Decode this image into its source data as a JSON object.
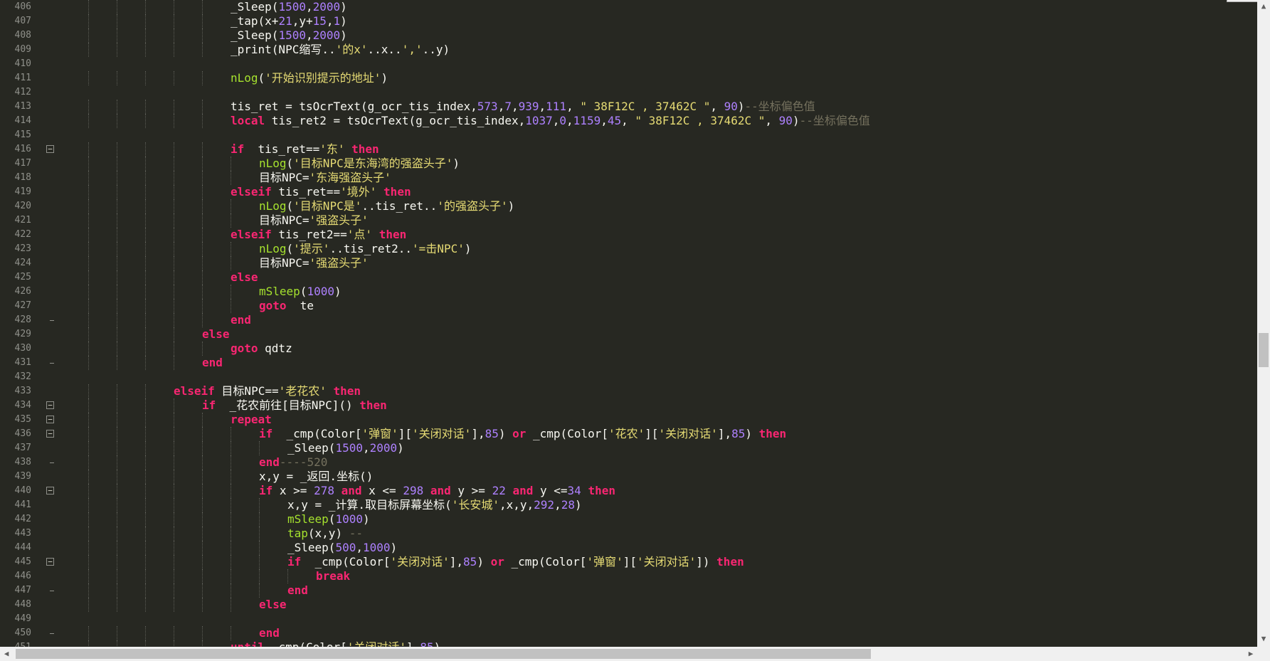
{
  "editor": {
    "lines": [
      {
        "n": "406",
        "indent": 6,
        "tokens": [
          [
            "_Sleep",
            "id"
          ],
          [
            "(",
            "id"
          ],
          [
            "1500",
            "num"
          ],
          [
            ",",
            "id"
          ],
          [
            "2000",
            "num"
          ],
          [
            ")",
            "id"
          ]
        ]
      },
      {
        "n": "407",
        "indent": 6,
        "tokens": [
          [
            "_tap",
            "id"
          ],
          [
            "(x+",
            "id"
          ],
          [
            "21",
            "num"
          ],
          [
            ",y+",
            "id"
          ],
          [
            "15",
            "num"
          ],
          [
            ",",
            "id"
          ],
          [
            "1",
            "num"
          ],
          [
            ")",
            "id"
          ]
        ]
      },
      {
        "n": "408",
        "indent": 6,
        "tokens": [
          [
            "_Sleep",
            "id"
          ],
          [
            "(",
            "id"
          ],
          [
            "1500",
            "num"
          ],
          [
            ",",
            "id"
          ],
          [
            "2000",
            "num"
          ],
          [
            ")",
            "id"
          ]
        ]
      },
      {
        "n": "409",
        "indent": 6,
        "tokens": [
          [
            "_print",
            "id"
          ],
          [
            "(NPC缩写..",
            "id"
          ],
          [
            "'的x'",
            "str"
          ],
          [
            "..x..",
            "id"
          ],
          [
            "','",
            "str"
          ],
          [
            "..y)",
            "id"
          ]
        ]
      },
      {
        "n": "410",
        "indent": 0,
        "tokens": []
      },
      {
        "n": "411",
        "indent": 6,
        "tokens": [
          [
            "nLog",
            "fn"
          ],
          [
            "(",
            "id"
          ],
          [
            "'开始识别提示的地址'",
            "str"
          ],
          [
            ")",
            "id"
          ]
        ]
      },
      {
        "n": "412",
        "indent": 0,
        "tokens": []
      },
      {
        "n": "413",
        "indent": 6,
        "tokens": [
          [
            "tis_ret = tsOcrText(g_ocr_tis_index,",
            "id"
          ],
          [
            "573",
            "num"
          ],
          [
            ",",
            "id"
          ],
          [
            "7",
            "num"
          ],
          [
            ",",
            "id"
          ],
          [
            "939",
            "num"
          ],
          [
            ",",
            "id"
          ],
          [
            "111",
            "num"
          ],
          [
            ", ",
            "id"
          ],
          [
            "\" 38F12C , 37462C \"",
            "str"
          ],
          [
            ", ",
            "id"
          ],
          [
            "90",
            "num"
          ],
          [
            ")",
            "id"
          ],
          [
            "--坐标偏色值",
            "cm"
          ]
        ]
      },
      {
        "n": "414",
        "indent": 6,
        "tokens": [
          [
            "local",
            "kw"
          ],
          [
            " tis_ret2 = tsOcrText(g_ocr_tis_index,",
            "id"
          ],
          [
            "1037",
            "num"
          ],
          [
            ",",
            "id"
          ],
          [
            "0",
            "num"
          ],
          [
            ",",
            "id"
          ],
          [
            "1159",
            "num"
          ],
          [
            ",",
            "id"
          ],
          [
            "45",
            "num"
          ],
          [
            ", ",
            "id"
          ],
          [
            "\" 38F12C , 37462C \"",
            "str"
          ],
          [
            ", ",
            "id"
          ],
          [
            "90",
            "num"
          ],
          [
            ")",
            "id"
          ],
          [
            "--坐标偏色值",
            "cm"
          ]
        ]
      },
      {
        "n": "415",
        "indent": 0,
        "tokens": []
      },
      {
        "n": "416",
        "indent": 6,
        "fold": "box",
        "tokens": [
          [
            "if",
            "kw"
          ],
          [
            "  tis_ret==",
            "id"
          ],
          [
            "'东'",
            "str"
          ],
          [
            " ",
            "id"
          ],
          [
            "then",
            "kw"
          ]
        ]
      },
      {
        "n": "417",
        "indent": 7,
        "tokens": [
          [
            "nLog",
            "fn"
          ],
          [
            "(",
            "id"
          ],
          [
            "'目标NPC是东海湾的强盗头子'",
            "str"
          ],
          [
            ")",
            "id"
          ]
        ]
      },
      {
        "n": "418",
        "indent": 7,
        "tokens": [
          [
            "目标NPC=",
            "id"
          ],
          [
            "'东海强盗头子'",
            "str"
          ]
        ]
      },
      {
        "n": "419",
        "indent": 6,
        "tokens": [
          [
            "elseif",
            "kw"
          ],
          [
            " tis_ret==",
            "id"
          ],
          [
            "'境外'",
            "str"
          ],
          [
            " ",
            "id"
          ],
          [
            "then",
            "kw"
          ]
        ]
      },
      {
        "n": "420",
        "indent": 7,
        "tokens": [
          [
            "nLog",
            "fn"
          ],
          [
            "(",
            "id"
          ],
          [
            "'目标NPC是'",
            "str"
          ],
          [
            "..tis_ret..",
            "id"
          ],
          [
            "'的强盗头子'",
            "str"
          ],
          [
            ")",
            "id"
          ]
        ]
      },
      {
        "n": "421",
        "indent": 7,
        "tokens": [
          [
            "目标NPC=",
            "id"
          ],
          [
            "'强盗头子'",
            "str"
          ]
        ]
      },
      {
        "n": "422",
        "indent": 6,
        "tokens": [
          [
            "elseif",
            "kw"
          ],
          [
            " tis_ret2==",
            "id"
          ],
          [
            "'点'",
            "str"
          ],
          [
            " ",
            "id"
          ],
          [
            "then",
            "kw"
          ]
        ]
      },
      {
        "n": "423",
        "indent": 7,
        "tokens": [
          [
            "nLog",
            "fn"
          ],
          [
            "(",
            "id"
          ],
          [
            "'提示'",
            "str"
          ],
          [
            "..tis_ret2..",
            "id"
          ],
          [
            "'=击NPC'",
            "str"
          ],
          [
            ")",
            "id"
          ]
        ]
      },
      {
        "n": "424",
        "indent": 7,
        "tokens": [
          [
            "目标NPC=",
            "id"
          ],
          [
            "'强盗头子'",
            "str"
          ]
        ]
      },
      {
        "n": "425",
        "indent": 6,
        "tokens": [
          [
            "else",
            "kw"
          ]
        ]
      },
      {
        "n": "426",
        "indent": 7,
        "tokens": [
          [
            "mSleep",
            "fn"
          ],
          [
            "(",
            "id"
          ],
          [
            "1000",
            "num"
          ],
          [
            ")",
            "id"
          ]
        ]
      },
      {
        "n": "427",
        "indent": 7,
        "tokens": [
          [
            "goto",
            "kw"
          ],
          [
            "  te",
            "id"
          ]
        ]
      },
      {
        "n": "428",
        "indent": 6,
        "fold": "end",
        "tokens": [
          [
            "end",
            "kw"
          ]
        ]
      },
      {
        "n": "429",
        "indent": 5,
        "tokens": [
          [
            "else",
            "kw"
          ]
        ]
      },
      {
        "n": "430",
        "indent": 6,
        "tokens": [
          [
            "goto",
            "kw"
          ],
          [
            " qdtz",
            "id"
          ]
        ]
      },
      {
        "n": "431",
        "indent": 5,
        "fold": "end",
        "tokens": [
          [
            "end",
            "kw"
          ]
        ]
      },
      {
        "n": "432",
        "indent": 0,
        "tokens": []
      },
      {
        "n": "433",
        "indent": 4,
        "tokens": [
          [
            "elseif",
            "kw"
          ],
          [
            " 目标NPC==",
            "id"
          ],
          [
            "'老花农'",
            "str"
          ],
          [
            " ",
            "id"
          ],
          [
            "then",
            "kw"
          ]
        ]
      },
      {
        "n": "434",
        "indent": 5,
        "fold": "box",
        "tokens": [
          [
            "if",
            "kw"
          ],
          [
            "  _花农前往[目标NPC]() ",
            "id"
          ],
          [
            "then",
            "kw"
          ]
        ]
      },
      {
        "n": "435",
        "indent": 6,
        "fold": "box",
        "tokens": [
          [
            "repeat",
            "kw"
          ]
        ]
      },
      {
        "n": "436",
        "indent": 7,
        "fold": "box",
        "tokens": [
          [
            "if",
            "kw"
          ],
          [
            "  _cmp(Color[",
            "id"
          ],
          [
            "'弹窗'",
            "str"
          ],
          [
            "][",
            "id"
          ],
          [
            "'关闭对话'",
            "str"
          ],
          [
            "],",
            "id"
          ],
          [
            "85",
            "num"
          ],
          [
            ") ",
            "id"
          ],
          [
            "or",
            "kw"
          ],
          [
            " _cmp(Color[",
            "id"
          ],
          [
            "'花农'",
            "str"
          ],
          [
            "][",
            "id"
          ],
          [
            "'关闭对话'",
            "str"
          ],
          [
            "],",
            "id"
          ],
          [
            "85",
            "num"
          ],
          [
            ") ",
            "id"
          ],
          [
            "then",
            "kw"
          ]
        ]
      },
      {
        "n": "437",
        "indent": 8,
        "tokens": [
          [
            "_Sleep",
            "id"
          ],
          [
            "(",
            "id"
          ],
          [
            "1500",
            "num"
          ],
          [
            ",",
            "id"
          ],
          [
            "2000",
            "num"
          ],
          [
            ")",
            "id"
          ]
        ]
      },
      {
        "n": "438",
        "indent": 7,
        "fold": "end",
        "tokens": [
          [
            "end",
            "kw"
          ],
          [
            "----520",
            "cm"
          ]
        ]
      },
      {
        "n": "439",
        "indent": 7,
        "tokens": [
          [
            "x,y = _返回.坐标()",
            "id"
          ]
        ]
      },
      {
        "n": "440",
        "indent": 7,
        "fold": "box",
        "tokens": [
          [
            "if",
            "kw"
          ],
          [
            " x >= ",
            "id"
          ],
          [
            "278",
            "num"
          ],
          [
            " ",
            "id"
          ],
          [
            "and",
            "kw"
          ],
          [
            " x <= ",
            "id"
          ],
          [
            "298",
            "num"
          ],
          [
            " ",
            "id"
          ],
          [
            "and",
            "kw"
          ],
          [
            " y >= ",
            "id"
          ],
          [
            "22",
            "num"
          ],
          [
            " ",
            "id"
          ],
          [
            "and",
            "kw"
          ],
          [
            " y <=",
            "id"
          ],
          [
            "34",
            "num"
          ],
          [
            " ",
            "id"
          ],
          [
            "then",
            "kw"
          ]
        ]
      },
      {
        "n": "441",
        "indent": 8,
        "tokens": [
          [
            "x,y = _计算.取目标屏幕坐标(",
            "id"
          ],
          [
            "'长安城'",
            "str"
          ],
          [
            ",x,y,",
            "id"
          ],
          [
            "292",
            "num"
          ],
          [
            ",",
            "id"
          ],
          [
            "28",
            "num"
          ],
          [
            ")",
            "id"
          ]
        ]
      },
      {
        "n": "442",
        "indent": 8,
        "tokens": [
          [
            "mSleep",
            "fn"
          ],
          [
            "(",
            "id"
          ],
          [
            "1000",
            "num"
          ],
          [
            ")",
            "id"
          ]
        ]
      },
      {
        "n": "443",
        "indent": 8,
        "tokens": [
          [
            "tap",
            "fn"
          ],
          [
            "(x,y) ",
            "id"
          ],
          [
            "--",
            "cm"
          ]
        ]
      },
      {
        "n": "444",
        "indent": 8,
        "tokens": [
          [
            "_Sleep",
            "id"
          ],
          [
            "(",
            "id"
          ],
          [
            "500",
            "num"
          ],
          [
            ",",
            "id"
          ],
          [
            "1000",
            "num"
          ],
          [
            ")",
            "id"
          ]
        ]
      },
      {
        "n": "445",
        "indent": 8,
        "fold": "box",
        "tokens": [
          [
            "if",
            "kw"
          ],
          [
            "  _cmp(Color[",
            "id"
          ],
          [
            "'关闭对话'",
            "str"
          ],
          [
            "],",
            "id"
          ],
          [
            "85",
            "num"
          ],
          [
            ") ",
            "id"
          ],
          [
            "or",
            "kw"
          ],
          [
            " _cmp(Color[",
            "id"
          ],
          [
            "'弹窗'",
            "str"
          ],
          [
            "][",
            "id"
          ],
          [
            "'关闭对话'",
            "str"
          ],
          [
            "]) ",
            "id"
          ],
          [
            "then",
            "kw"
          ]
        ]
      },
      {
        "n": "446",
        "indent": 9,
        "tokens": [
          [
            "break",
            "kw"
          ]
        ]
      },
      {
        "n": "447",
        "indent": 8,
        "fold": "end",
        "tokens": [
          [
            "end",
            "kw"
          ]
        ]
      },
      {
        "n": "448",
        "indent": 7,
        "tokens": [
          [
            "else",
            "kw"
          ]
        ]
      },
      {
        "n": "449",
        "indent": 0,
        "tokens": []
      },
      {
        "n": "450",
        "indent": 7,
        "fold": "end",
        "tokens": [
          [
            "end",
            "kw"
          ]
        ]
      },
      {
        "n": "451",
        "indent": 6,
        "tokens": [
          [
            "until",
            "kw"
          ],
          [
            " _cmp(Color[",
            "id"
          ],
          [
            "'关闭对话'",
            "str"
          ],
          [
            "],",
            "id"
          ],
          [
            "85",
            "num"
          ],
          [
            ")",
            "id"
          ]
        ]
      }
    ]
  },
  "scrollbars": {
    "vertical_position": 0.53,
    "horizontal_position": 0.0
  },
  "colors": {
    "background": "#272822",
    "keyword": "#f92672",
    "function": "#a6e22e",
    "string": "#e6db74",
    "number": "#ae81ff",
    "comment": "#75715e",
    "text": "#f8f8f2",
    "line_number": "#8f908a"
  },
  "icons": {
    "fold_open": "minus-box-icon",
    "scroll_up": "arrow-up-icon",
    "scroll_down": "arrow-down-icon",
    "scroll_left": "arrow-left-icon",
    "scroll_right": "arrow-right-icon"
  }
}
